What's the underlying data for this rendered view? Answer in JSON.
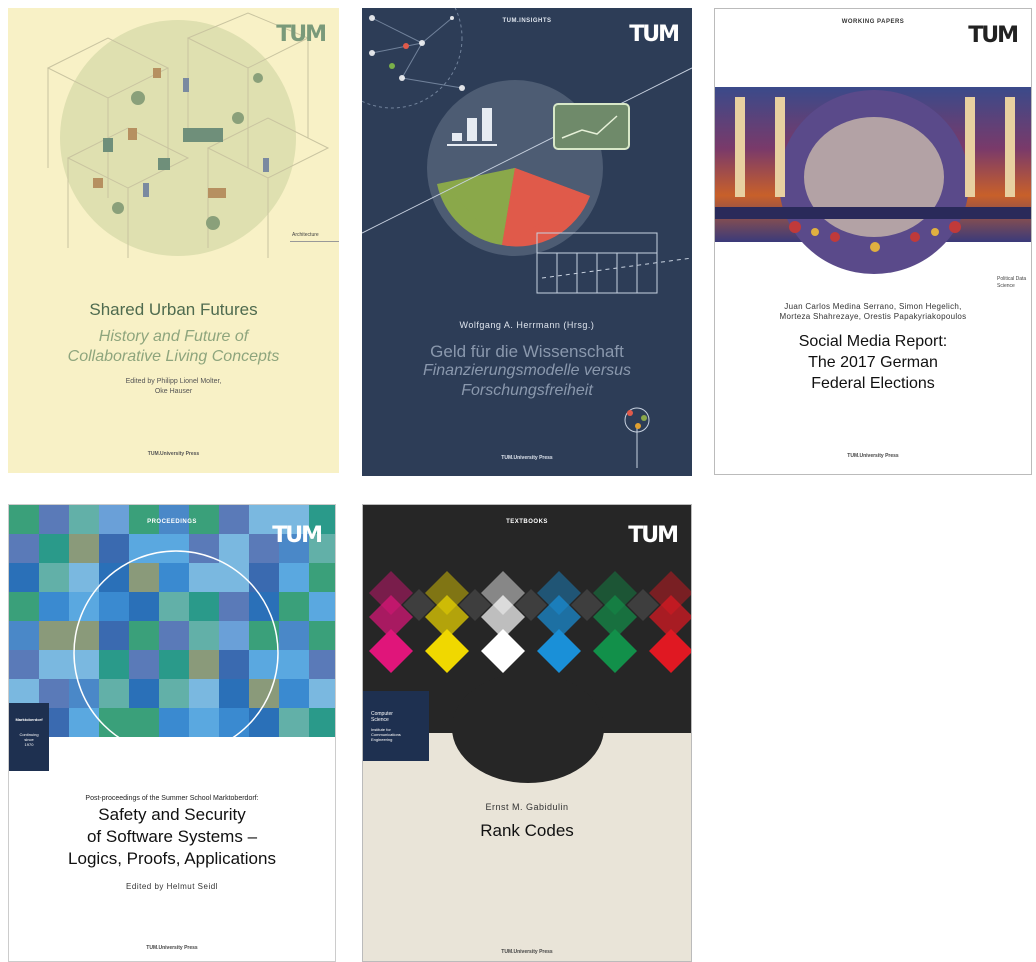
{
  "tum_logo": "TUM",
  "books": [
    {
      "id": "shared-urban-futures",
      "tag": "Architecture",
      "title": "Shared Urban Futures",
      "subtitle_line1": "History and Future of",
      "subtitle_line2": "Collaborative Living Concepts",
      "editors_line1": "Edited by Philipp Lionel Molter,",
      "editors_line2": "Oke Hauser",
      "press": "TUM.University Press",
      "bg": "#f8f1c6"
    },
    {
      "id": "geld-fuer-die-wissenschaft",
      "series": "TUM.INSIGHTS",
      "author": "Wolfgang A. Herrmann (Hrsg.)",
      "title": "Geld für die Wissenschaft",
      "subtitle_line1": "Finanzierungsmodelle versus",
      "subtitle_line2": "Forschungsfreiheit",
      "press": "TUM.University Press",
      "bg": "#2d3d57"
    },
    {
      "id": "social-media-report",
      "series": "WORKING PAPERS",
      "tag_line1": "Political Data",
      "tag_line2": "Science",
      "authors_line1": "Juan Carlos Medina Serrano, Simon Hegelich,",
      "authors_line2": "Morteza Shahrezaye, Orestis Papakyriakopoulos",
      "title_line1": "Social Media Report:",
      "title_line2": "The 2017 German",
      "title_line3": "Federal Elections",
      "press": "TUM.University Press"
    },
    {
      "id": "safety-and-security",
      "series": "PROCEEDINGS",
      "badge_title": "Marktoberdorf",
      "badge_line1": "Continuing",
      "badge_line2": "since",
      "badge_line3": "1970",
      "kicker": "Post-proceedings of the Summer School Marktoberdorf:",
      "title_line1": "Safety and Security",
      "title_line2": "of Software Systems –",
      "title_line3": "Logics, Proofs, Applications",
      "editor": "Edited by Helmut Seidl",
      "press": "TUM.University Press"
    },
    {
      "id": "rank-codes",
      "series": "TEXTBOOKS",
      "badge_title_line1": "Computer",
      "badge_title_line2": "Science",
      "badge_line1": "Institute for",
      "badge_line2": "Communications",
      "badge_line3": "Engineering",
      "author": "Ernst M. Gabidulin",
      "title": "Rank Codes",
      "press": "TUM.University Press"
    }
  ]
}
